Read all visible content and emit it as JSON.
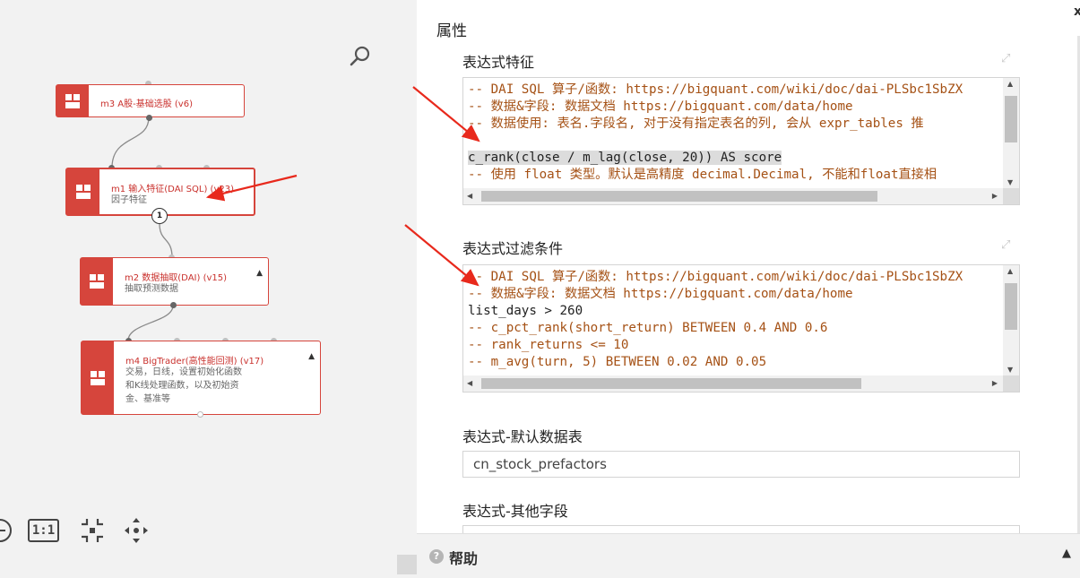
{
  "colors": {
    "accent": "#d6453c",
    "arrow": "#e8291c"
  },
  "canvas": {
    "nodes": [
      {
        "id": "m3",
        "title": "m3 A股-基础选股 (v6)",
        "subtitle": ""
      },
      {
        "id": "m1",
        "title": "m1 输入特征(DAI SQL) (v23)",
        "subtitle": "因子特征"
      },
      {
        "id": "m2",
        "title": "m2 数据抽取(DAI) (v15)",
        "subtitle": "抽取预测数据"
      },
      {
        "id": "m4",
        "title": "m4 BigTrader(高性能回测) (v17)",
        "subtitle_lines": [
          "交易，日线，设置初始化函数",
          "和K线处理函数，以及初始资",
          "金、基准等"
        ]
      }
    ],
    "badge_label": "1",
    "toolbar": {
      "zoom_reset_label": "1:1"
    },
    "icons": [
      "search-icon",
      "zoom-out-icon",
      "fit-icon",
      "move-icon",
      "grid-icon"
    ]
  },
  "panel": {
    "title": "属性",
    "close_label": "x",
    "fields": {
      "expr_feature": {
        "label": "表达式特征",
        "lines": [
          "-- DAI SQL 算子/函数: https://bigquant.com/wiki/doc/dai-PLSbc1SbZX",
          "-- 数据&字段: 数据文档 https://bigquant.com/data/home",
          "-- 数据使用: 表名.字段名, 对于没有指定表名的列, 会从 expr_tables 推",
          "",
          "c_rank(close / m_lag(close, 20)) AS score",
          "-- 使用 float 类型。默认是高精度 decimal.Decimal, 不能和float直接相"
        ]
      },
      "expr_filter": {
        "label": "表达式过滤条件",
        "lines": [
          "-- DAI SQL 算子/函数: https://bigquant.com/wiki/doc/dai-PLSbc1SbZX",
          "-- 数据&字段: 数据文档 https://bigquant.com/data/home",
          "list_days > 260",
          "-- c_pct_rank(short_return) BETWEEN 0.4 AND 0.6",
          "-- rank_returns <= 10",
          "-- m_avg(turn, 5) BETWEEN 0.02 AND 0.05"
        ]
      },
      "default_table": {
        "label": "表达式-默认数据表",
        "value": "cn_stock_prefactors"
      },
      "other_fields": {
        "label": "表达式-其他字段",
        "value": ""
      }
    },
    "help": {
      "label": "帮助",
      "icon_label": "?"
    }
  }
}
